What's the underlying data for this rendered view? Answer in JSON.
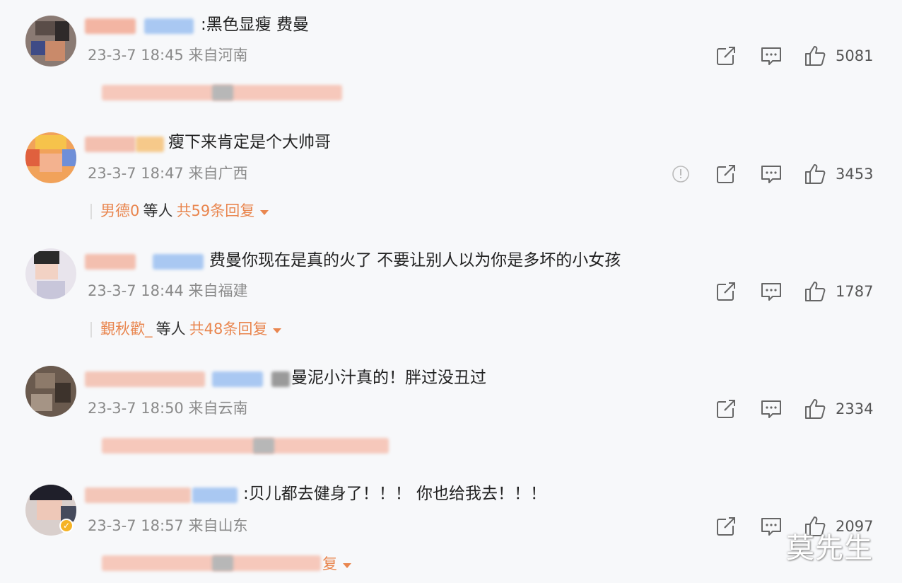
{
  "comments": [
    {
      "text": ":黑色显瘦 费曼",
      "date": "23-3-7 18:45",
      "location": "来自河南",
      "likes": "5081",
      "has_report": false,
      "replies": null
    },
    {
      "text": "瘦下来肯定是个大帅哥",
      "date": "23-3-7 18:47",
      "location": "来自广西",
      "likes": "3453",
      "has_report": true,
      "replies": {
        "name": "男德0",
        "etc": "等人",
        "total": "共59条回复"
      }
    },
    {
      "text": "费曼你现在是真的火了 不要让别人以为你是多坏的小女孩",
      "date": "23-3-7 18:44",
      "location": "来自福建",
      "likes": "1787",
      "has_report": false,
      "replies": {
        "name": "覲秋歡_",
        "etc": "等人",
        "total": "共48条回复"
      }
    },
    {
      "text": "曼泥小汁真的！胖过没丑过",
      "date": "23-3-7 18:50",
      "location": "来自云南",
      "likes": "2334",
      "has_report": false,
      "replies": null
    },
    {
      "text": ":贝儿都去健身了！！！ 你也给我去！！！",
      "date": "23-3-7 18:57",
      "location": "来自山东",
      "likes": "2097",
      "has_report": false,
      "replies": {
        "name": "",
        "etc": "",
        "total": "复"
      }
    }
  ],
  "watermark": "莫先生",
  "icons": {
    "share": "share-icon",
    "comment": "comment-icon",
    "like": "thumbs-up-icon",
    "report": "warning-icon"
  },
  "colors": {
    "accent": "#e9864f",
    "meta": "#8a8a8a",
    "background": "#f7f8fa"
  }
}
